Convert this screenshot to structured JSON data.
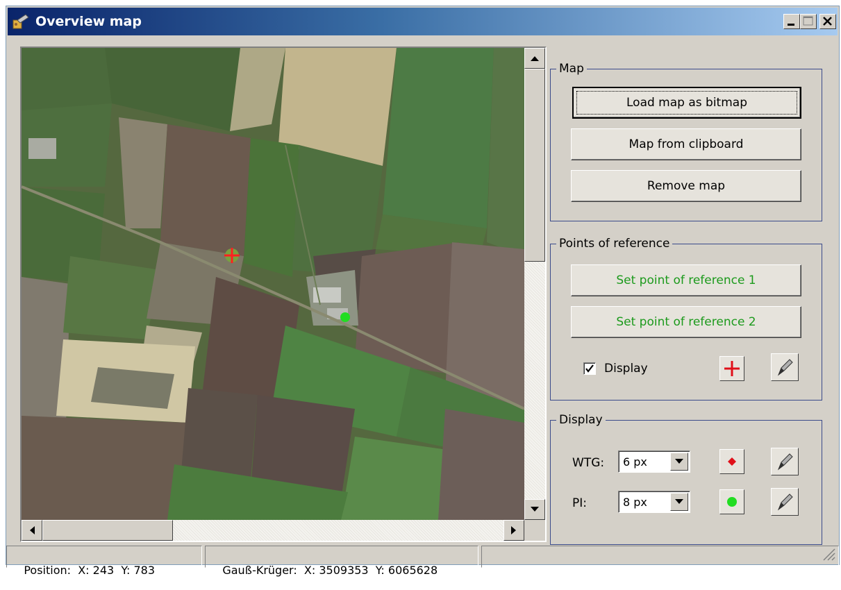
{
  "window": {
    "title": "Overview map",
    "controls": {
      "minimize": "_",
      "maximize": "□",
      "close": "✕"
    }
  },
  "map_panel": {
    "icon_names": [
      "reference-point-1-cross-icon",
      "reference-point-2-dot-icon"
    ],
    "colors": {
      "reference_1": "#ff2020",
      "reference_2": "#22dd22"
    }
  },
  "map_group": {
    "legend": "Map",
    "load_bitmap": "Load map as bitmap",
    "from_clipboard": "Map from clipboard",
    "remove": "Remove map"
  },
  "reference_group": {
    "legend": "Points of reference",
    "set_ref_1": "Set point of reference 1",
    "set_ref_2": "Set point of reference 2",
    "display_label": "Display",
    "display_checked": true,
    "marker_icon": "red-cross-icon",
    "pencil_icon": "pencil-icon"
  },
  "display_group": {
    "legend": "Display",
    "wtg_label": "WTG:",
    "wtg_value": "6 px",
    "wtg_color": "#e0101a",
    "pi_label": "PI:",
    "pi_value": "8 px",
    "pi_color": "#22dd22"
  },
  "status_bar": {
    "position": "Position:  X: 243  Y: 783",
    "gauss_kruger": "Gauß-Krüger:  X: 3509353  Y: 6065628"
  }
}
